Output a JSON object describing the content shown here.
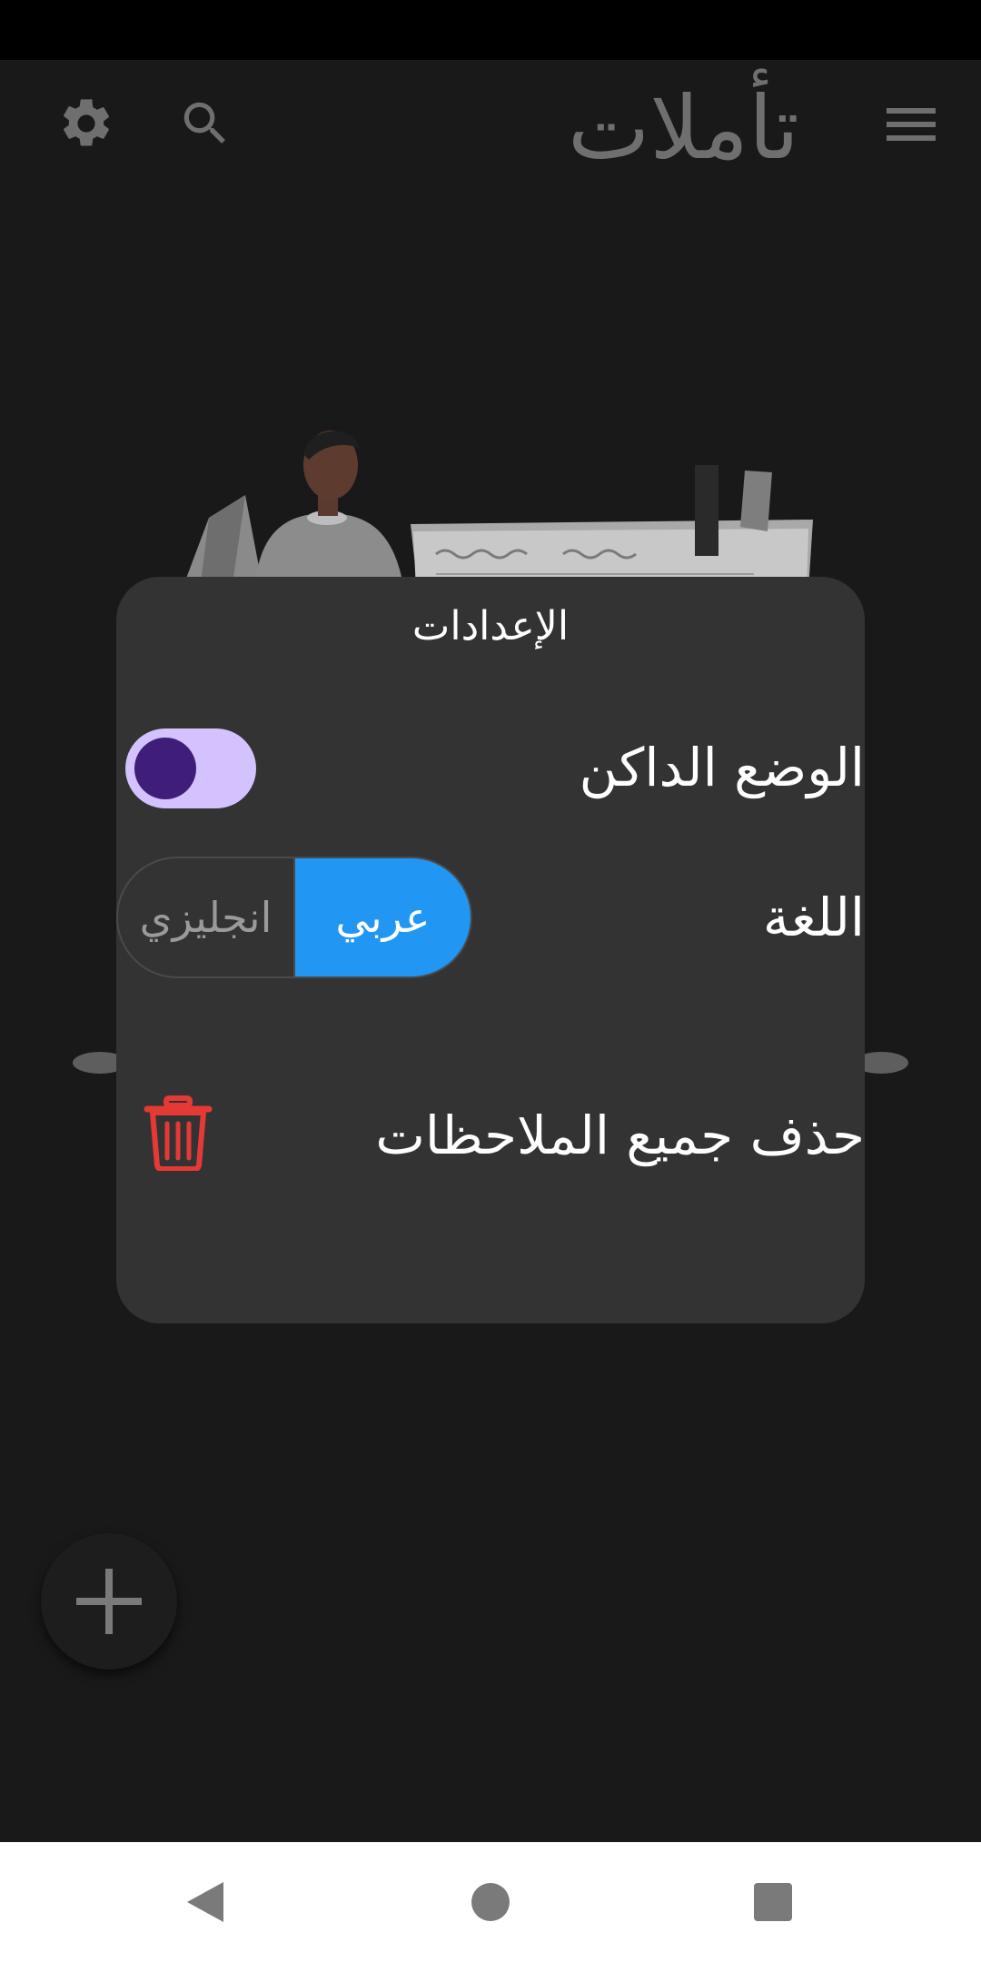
{
  "app": {
    "title": "تأملات"
  },
  "icons": {
    "settings": "gear-icon",
    "search": "search-icon",
    "menu": "hamburger-menu-icon",
    "delete": "trash-icon",
    "add": "plus-icon",
    "nav_back": "triangle-back-icon",
    "nav_home": "circle-home-icon",
    "nav_recents": "square-recents-icon"
  },
  "dialog": {
    "title": "الإعدادات",
    "dark_mode_label": "الوضع الداكن",
    "dark_mode_enabled": true,
    "language_label": "اللغة",
    "language_options": [
      "انجليزي",
      "عربي"
    ],
    "language_selected": "عربي",
    "delete_all_label": "حذف جميع الملاحظات"
  },
  "colors": {
    "background": "#191919",
    "dialog_bg": "#333333",
    "accent_blue": "#2196f3",
    "switch_track": "#d3c2fd",
    "switch_knob": "#3e1e79",
    "delete_red": "#e53935"
  }
}
